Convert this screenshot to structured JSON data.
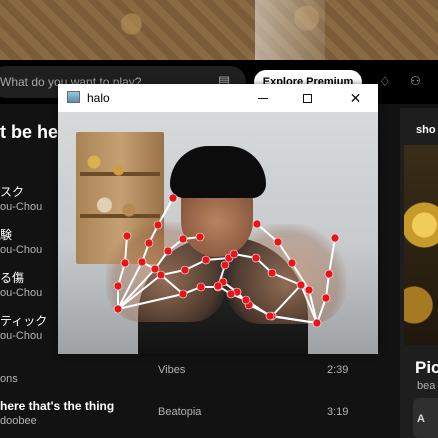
{
  "topbar": {
    "search_placeholder": "What do you want to play?",
    "explore_label": "Explore Premium"
  },
  "library": {
    "section_title": "t be her",
    "tracks": [
      {
        "title": "スク",
        "artist": "ou-Chou"
      },
      {
        "title": "験",
        "artist": "ou-Chou"
      },
      {
        "title": "る傷",
        "artist": "ou-Chou"
      },
      {
        "title": "ティック",
        "artist": "ou-Chou"
      }
    ]
  },
  "main": {
    "rows": [
      {
        "title": "ons",
        "album": "Vibes",
        "duration": "2:39"
      },
      {
        "title": "here that's the thing",
        "artist": "doobee",
        "album": "Beatopia",
        "duration": "3:19"
      }
    ]
  },
  "right_panel": {
    "title": "sho",
    "big_text": "Pic",
    "sub_text": "bea",
    "card_text": "A"
  },
  "camera_window": {
    "title": "halo"
  },
  "colors": {
    "accent": "#ffffff",
    "landmark_point": "#e8141b",
    "landmark_line": "#ffffff"
  },
  "icons": {
    "search": "search-icon",
    "browse": "browse-icon",
    "bell": "bell-icon",
    "friends": "friends-icon",
    "minimize": "minimize-icon",
    "maximize": "maximize-icon",
    "close": "close-icon",
    "app": "app-icon"
  }
}
